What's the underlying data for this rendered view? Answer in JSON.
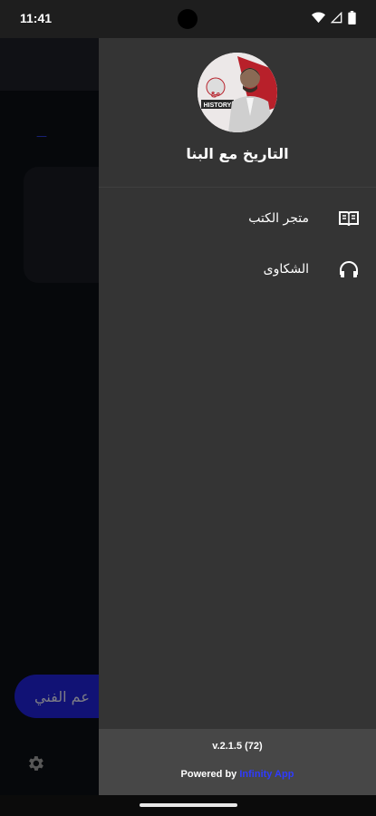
{
  "status_bar": {
    "time": "11:41"
  },
  "background_app": {
    "support_button_label": "عم الفني"
  },
  "drawer": {
    "title": "التاريخ مع البنا",
    "avatar_caption": "HISTORY",
    "menu": [
      {
        "label": "متجر الكتب",
        "icon": "book-icon"
      },
      {
        "label": "الشكاوى",
        "icon": "headphones-icon"
      }
    ],
    "footer": {
      "version": "v.2.1.5 (72)",
      "powered_prefix": "Powered by",
      "powered_brand": "Infinity App"
    }
  },
  "colors": {
    "drawer_bg": "#343434",
    "footer_bg": "#474747",
    "brand_blue": "#2f3bff",
    "pill_blue": "#1c1dbd"
  }
}
